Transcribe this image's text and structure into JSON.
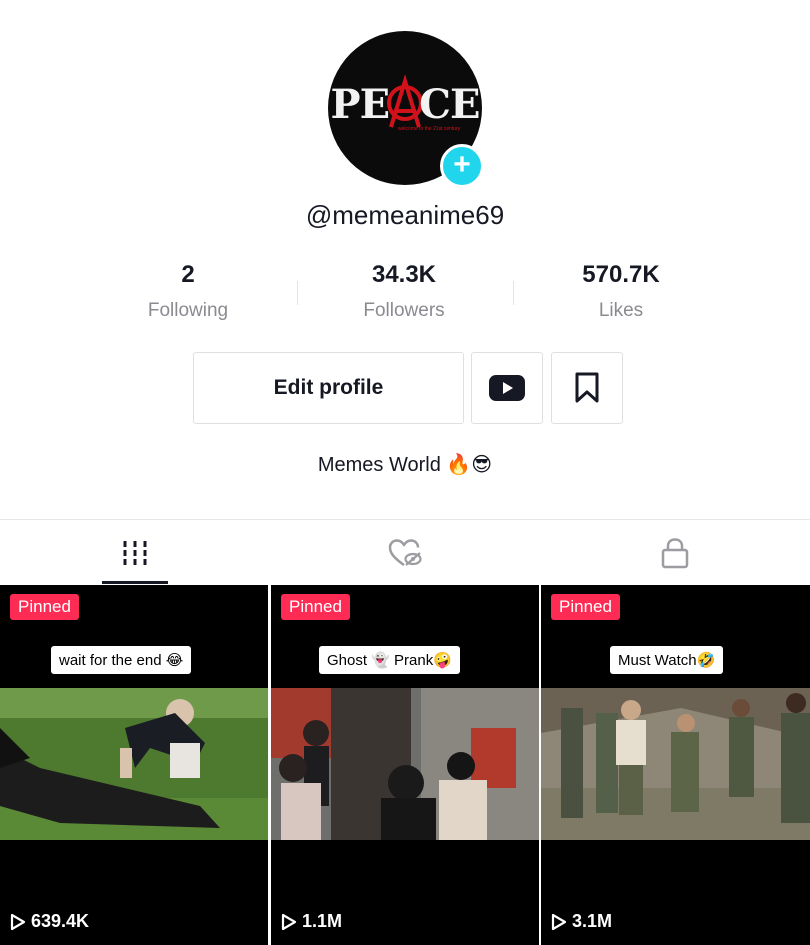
{
  "profile": {
    "avatar_text": "PEACE",
    "avatar_subtext": "welcome to the 21st century",
    "add_badge": "+",
    "username": "@memeanime69",
    "bio": "Memes World 🔥😎"
  },
  "stats": {
    "following": {
      "value": "2",
      "label": "Following"
    },
    "followers": {
      "value": "34.3K",
      "label": "Followers"
    },
    "likes": {
      "value": "570.7K",
      "label": "Likes"
    }
  },
  "actions": {
    "edit_label": "Edit profile",
    "youtube_icon": "youtube-icon",
    "bookmark_icon": "bookmark-icon"
  },
  "tabs": [
    {
      "icon": "grid-icon",
      "active": true
    },
    {
      "icon": "liked-hidden-icon",
      "active": false
    },
    {
      "icon": "lock-icon",
      "active": false
    }
  ],
  "videos": [
    {
      "badge": "Pinned",
      "caption": "wait for the end 😂",
      "views": "639.4K"
    },
    {
      "badge": "Pinned",
      "caption": "Ghost 👻 Prank🤪",
      "views": "1.1M"
    },
    {
      "badge": "Pinned",
      "caption": "Must Watch🤣",
      "views": "3.1M"
    }
  ],
  "colors": {
    "accent_pink": "#fe2c55",
    "badge_cyan": "#20d5ec",
    "text_primary": "#161823",
    "text_secondary": "#8a8b91"
  }
}
